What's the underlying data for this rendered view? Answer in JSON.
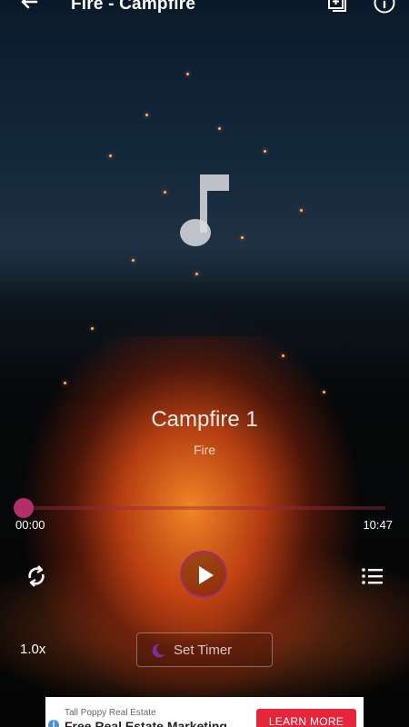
{
  "header": {
    "title": "Fire - Campfire",
    "back_icon": "arrow-left-icon",
    "add_icon": "add-to-playlist-icon",
    "info_icon": "info-icon"
  },
  "artwork": {
    "icon": "music-note-icon"
  },
  "track": {
    "title": "Campfire 1",
    "subtitle": "Fire"
  },
  "player": {
    "current_time": "00:00",
    "duration": "10:47",
    "progress": 0.0,
    "accent_color": "#b2306a",
    "repeat_icon": "repeat-icon",
    "play_icon": "play-icon",
    "list_icon": "playlist-icon",
    "speed": "1.0x",
    "timer_label": "Set Timer",
    "timer_icon": "moon-icon"
  },
  "ad": {
    "brand": "Tall Poppy Real Estate",
    "headline": "Free Real Estate Marketing",
    "cta": "LEARN MORE",
    "info_icon": "ad-info-icon",
    "cta_color": "#e6253a"
  }
}
